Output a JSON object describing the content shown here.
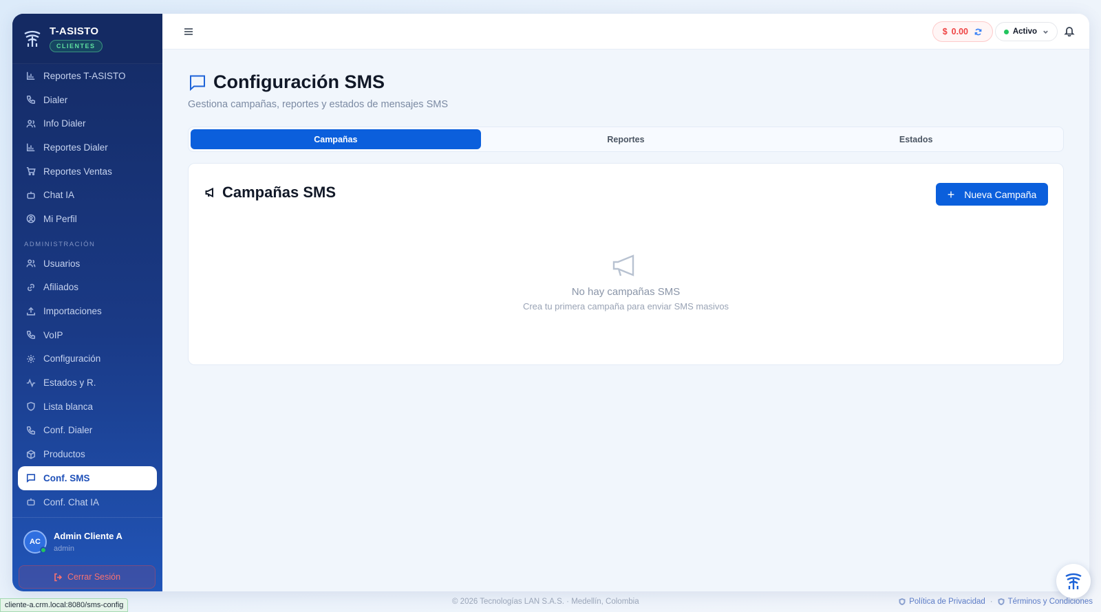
{
  "brand": {
    "name": "T-ASISTO",
    "badge": "CLIENTES"
  },
  "sidebar": {
    "items_top": [
      {
        "label": "Reportes T-ASISTO",
        "icon": "bar-chart-icon"
      },
      {
        "label": "Dialer",
        "icon": "phone-icon"
      },
      {
        "label": "Info Dialer",
        "icon": "users-icon"
      },
      {
        "label": "Reportes Dialer",
        "icon": "bar-chart-icon"
      },
      {
        "label": "Reportes Ventas",
        "icon": "cart-icon"
      },
      {
        "label": "Chat IA",
        "icon": "bot-icon"
      },
      {
        "label": "Mi Perfil",
        "icon": "user-circle-icon"
      }
    ],
    "section_admin": "ADMINISTRACIÓN",
    "items_admin": [
      {
        "label": "Usuarios",
        "icon": "users-icon"
      },
      {
        "label": "Afiliados",
        "icon": "link-icon"
      },
      {
        "label": "Importaciones",
        "icon": "upload-icon"
      },
      {
        "label": "VoIP",
        "icon": "phone-icon"
      },
      {
        "label": "Configuración",
        "icon": "gear-icon"
      },
      {
        "label": "Estados y R.",
        "icon": "activity-icon"
      },
      {
        "label": "Lista blanca",
        "icon": "shield-icon"
      },
      {
        "label": "Conf. Dialer",
        "icon": "phone-icon"
      },
      {
        "label": "Productos",
        "icon": "box-icon"
      },
      {
        "label": "Conf. SMS",
        "icon": "message-icon",
        "active": true
      },
      {
        "label": "Conf. Chat IA",
        "icon": "bot-icon"
      }
    ],
    "user": {
      "initials": "AC",
      "name": "Admin Cliente A",
      "role": "admin"
    },
    "logout_label": "Cerrar Sesión"
  },
  "topbar": {
    "balance_currency": "$",
    "balance": "0.00",
    "status": "Activo"
  },
  "page": {
    "title": "Configuración SMS",
    "subtitle": "Gestiona campañas, reportes y estados de mensajes SMS",
    "tabs": [
      "Campañas",
      "Reportes",
      "Estados"
    ],
    "active_tab": "Campañas"
  },
  "card": {
    "title": "Campañas SMS",
    "new_button": "Nueva Campaña",
    "empty_title": "No hay campañas SMS",
    "empty_subtitle": "Crea tu primera campaña para enviar SMS masivos"
  },
  "footer": {
    "copyright": "© 2026 Tecnologías LAN S.A.S. · Medellín, Colombia",
    "privacy": "Política de Privacidad",
    "sep": "·",
    "terms": "Términos y Condiciones"
  },
  "status_url": "cliente-a.crm.local:8080/sms-config",
  "colors": {
    "primary": "#0b5fdc",
    "sidebar": "#142a63",
    "danger": "#ef4444",
    "success": "#22c55e"
  }
}
